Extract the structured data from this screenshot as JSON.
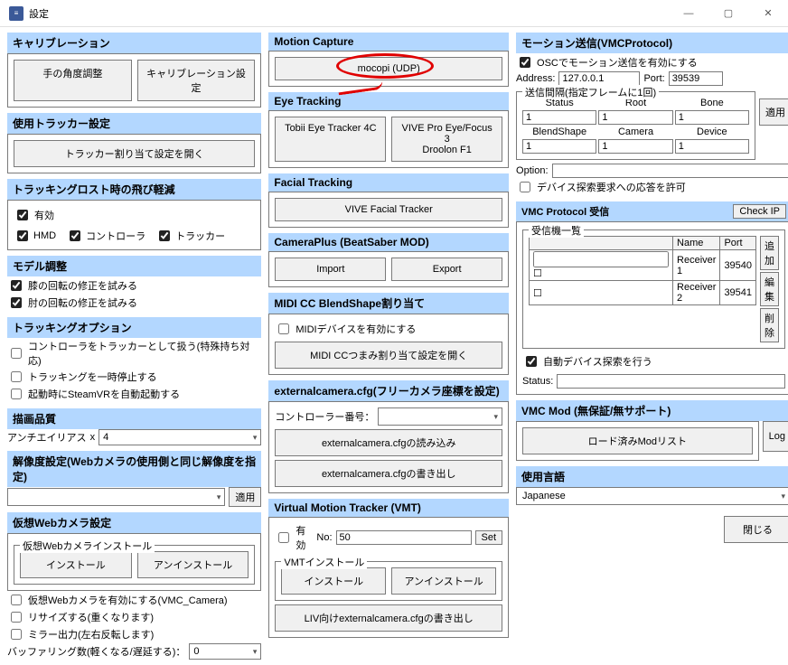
{
  "window": {
    "title": "設定"
  },
  "winctrl": {
    "min": "—",
    "max": "▢",
    "close": "✕"
  },
  "col1": {
    "calibration": {
      "header": "キャリブレーション",
      "btn_hand": "手の角度調整",
      "btn_cal": "キャリブレーション設定"
    },
    "tracker_settings": {
      "header": "使用トラッカー設定",
      "btn": "トラッカー割り当て設定を開く"
    },
    "tracking_lost": {
      "header": "トラッキングロスト時の飛び軽減",
      "enabled": "有効",
      "hmd": "HMD",
      "controller": "コントローラ",
      "tracker": "トラッカー"
    },
    "model_adjust": {
      "header": "モデル調整",
      "knee": "膝の回転の修正を試みる",
      "elbow": "肘の回転の修正を試みる"
    },
    "tracking_options": {
      "header": "トラッキングオプション",
      "ctrl_as_tracker": "コントローラをトラッカーとして扱う(特殊持ち対応)",
      "pause": "トラッキングを一時停止する",
      "autostart": "起動時にSteamVRを自動起動する"
    },
    "render_quality": {
      "header": "描画品質",
      "aa_label": "アンチエイリアス",
      "x": "x",
      "aa_val": "4"
    },
    "resolution": {
      "header": "解像度設定(Webカメラの使用側と同じ解像度を指定)",
      "apply": "適用"
    },
    "virtual_cam": {
      "header": "仮想Webカメラ設定",
      "group": "仮想Webカメラインストール",
      "install": "インストール",
      "uninstall": "アンインストール",
      "enable": "仮想Webカメラを有効にする(VMC_Camera)",
      "resize": "リサイズする(重くなります)",
      "mirror": "ミラー出力(左右反転します)",
      "buffer_label": "バッファリング数(軽くなる/遅延する)：",
      "buffer_val": "0"
    }
  },
  "col2": {
    "mocap": {
      "header": "Motion Capture",
      "btn": "mocopi (UDP)"
    },
    "eye": {
      "header": "Eye Tracking",
      "btn1": "Tobii Eye Tracker 4C",
      "btn2": "VIVE Pro Eye/Focus 3\nDroolon F1"
    },
    "facial": {
      "header": "Facial Tracking",
      "btn": "VIVE Facial Tracker"
    },
    "cameraplus": {
      "header": "CameraPlus (BeatSaber MOD)",
      "import": "Import",
      "export": "Export"
    },
    "midi": {
      "header": "MIDI CC BlendShape割り当て",
      "enable": "MIDIデバイスを有効にする",
      "open": "MIDI CCつまみ割り当て設定を開く"
    },
    "extcam": {
      "header": "externalcamera.cfg(フリーカメラ座標を設定)",
      "ctrl_no": "コントローラー番号：",
      "read": "externalcamera.cfgの読み込み",
      "write": "externalcamera.cfgの書き出し"
    },
    "vmt": {
      "header": "Virtual Motion Tracker (VMT)",
      "enable": "有効",
      "no_label": "No:",
      "no_val": "50",
      "set": "Set",
      "group": "VMTインストール",
      "install": "インストール",
      "uninstall": "アンインストール",
      "liv": "LIV向けexternalcamera.cfgの書き出し"
    }
  },
  "col3": {
    "motion_send": {
      "header": "モーション送信(VMCProtocol)",
      "osc": "OSCでモーション送信を有効にする",
      "addr_label": "Address:",
      "addr_val": "127.0.0.1",
      "port_label": "Port:",
      "port_val": "39539",
      "interval_group": "送信間隔(指定フレームに1回)",
      "h1": "Status",
      "h2": "Root",
      "h3": "Bone",
      "v1": "1",
      "v2": "1",
      "v3": "1",
      "h4": "BlendShape",
      "h5": "Camera",
      "h6": "Device",
      "v4": "1",
      "v5": "1",
      "v6": "1",
      "opt_label": "Option:",
      "device_discovery": "デバイス探索要求への応答を許可",
      "apply": "適用"
    },
    "vmc_recv": {
      "header": "VMC Protocol 受信",
      "check_ip": "Check IP",
      "group": "受信機一覧",
      "col_name": "Name",
      "col_port": "Port",
      "rows": [
        {
          "name": "Receiver 1",
          "port": "39540"
        },
        {
          "name": "Receiver 2",
          "port": "39541"
        }
      ],
      "add": "追加",
      "edit": "編集",
      "del": "削除",
      "auto": "自動デバイス探索を行う",
      "status": "Status:"
    },
    "vmc_mod": {
      "header": "VMC Mod (無保証/無サポート)",
      "list": "ロード済みModリスト",
      "log": "Log"
    },
    "lang": {
      "header": "使用言語",
      "value": "Japanese"
    },
    "close": "閉じる"
  }
}
